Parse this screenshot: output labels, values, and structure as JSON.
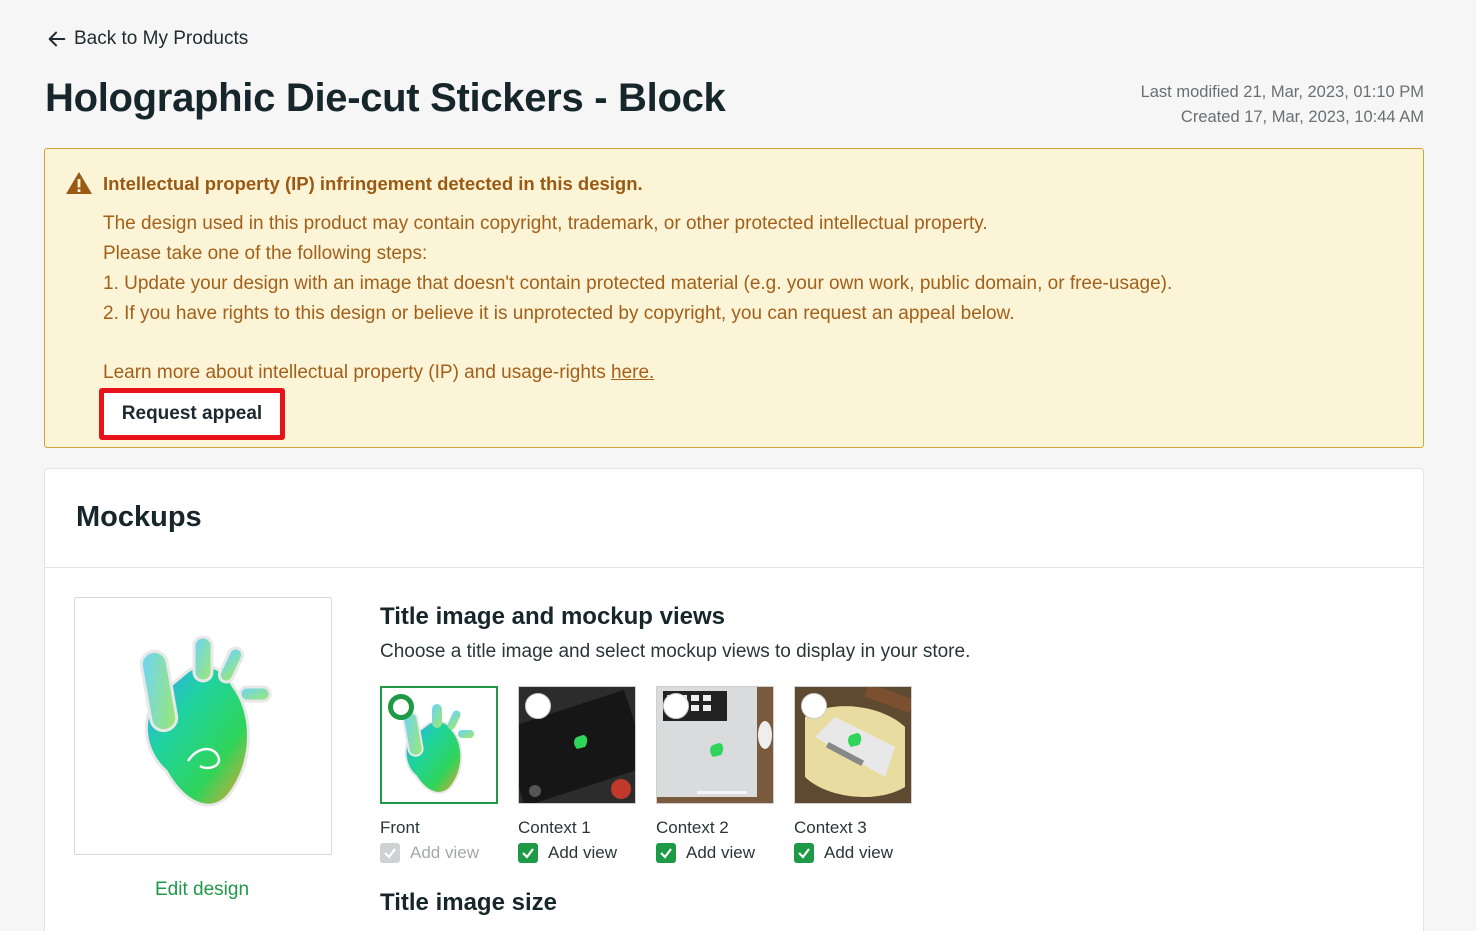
{
  "nav": {
    "back_label": "Back to My Products"
  },
  "product": {
    "title": "Holographic Die-cut Stickers - Block",
    "last_modified": "Last modified 21, Mar, 2023, 01:10 PM",
    "created": "Created 17, Mar, 2023, 10:44 AM"
  },
  "alert": {
    "title": "Intellectual property (IP) infringement detected in this design.",
    "line1": "The design used in this product may contain copyright, trademark, or other protected intellectual property.",
    "line2": "Please take one of the following steps:",
    "line3": "1. Update your design with an image that doesn't contain protected material (e.g. your own work, public domain, or free-usage).",
    "line4": "2. If you have rights to this design or believe it is unprotected by copyright, you can request an appeal below.",
    "learn_more": "Learn more about intellectual property (IP) and usage-rights ",
    "link_text": "here.",
    "appeal_label": "Request appeal",
    "colors": {
      "background": "#fcf4d6",
      "border": "#d4a63a",
      "text": "#a2601b",
      "highlight": "#e8121a"
    }
  },
  "mockups": {
    "title": "Mockups",
    "edit_design": "Edit design",
    "section_title": "Title image and mockup views",
    "section_sub": "Choose a title image and select mockup views to display in your store.",
    "views": [
      {
        "label": "Front",
        "add_label": "Add view",
        "selected": true,
        "checked": true,
        "disabled": true
      },
      {
        "label": "Context 1",
        "add_label": "Add view",
        "selected": false,
        "checked": true,
        "disabled": false
      },
      {
        "label": "Context 2",
        "add_label": "Add view",
        "selected": false,
        "checked": true,
        "disabled": false
      },
      {
        "label": "Context 3",
        "add_label": "Add view",
        "selected": false,
        "checked": true,
        "disabled": false
      }
    ],
    "size_title": "Title image size",
    "accent": "#1e9a47"
  }
}
